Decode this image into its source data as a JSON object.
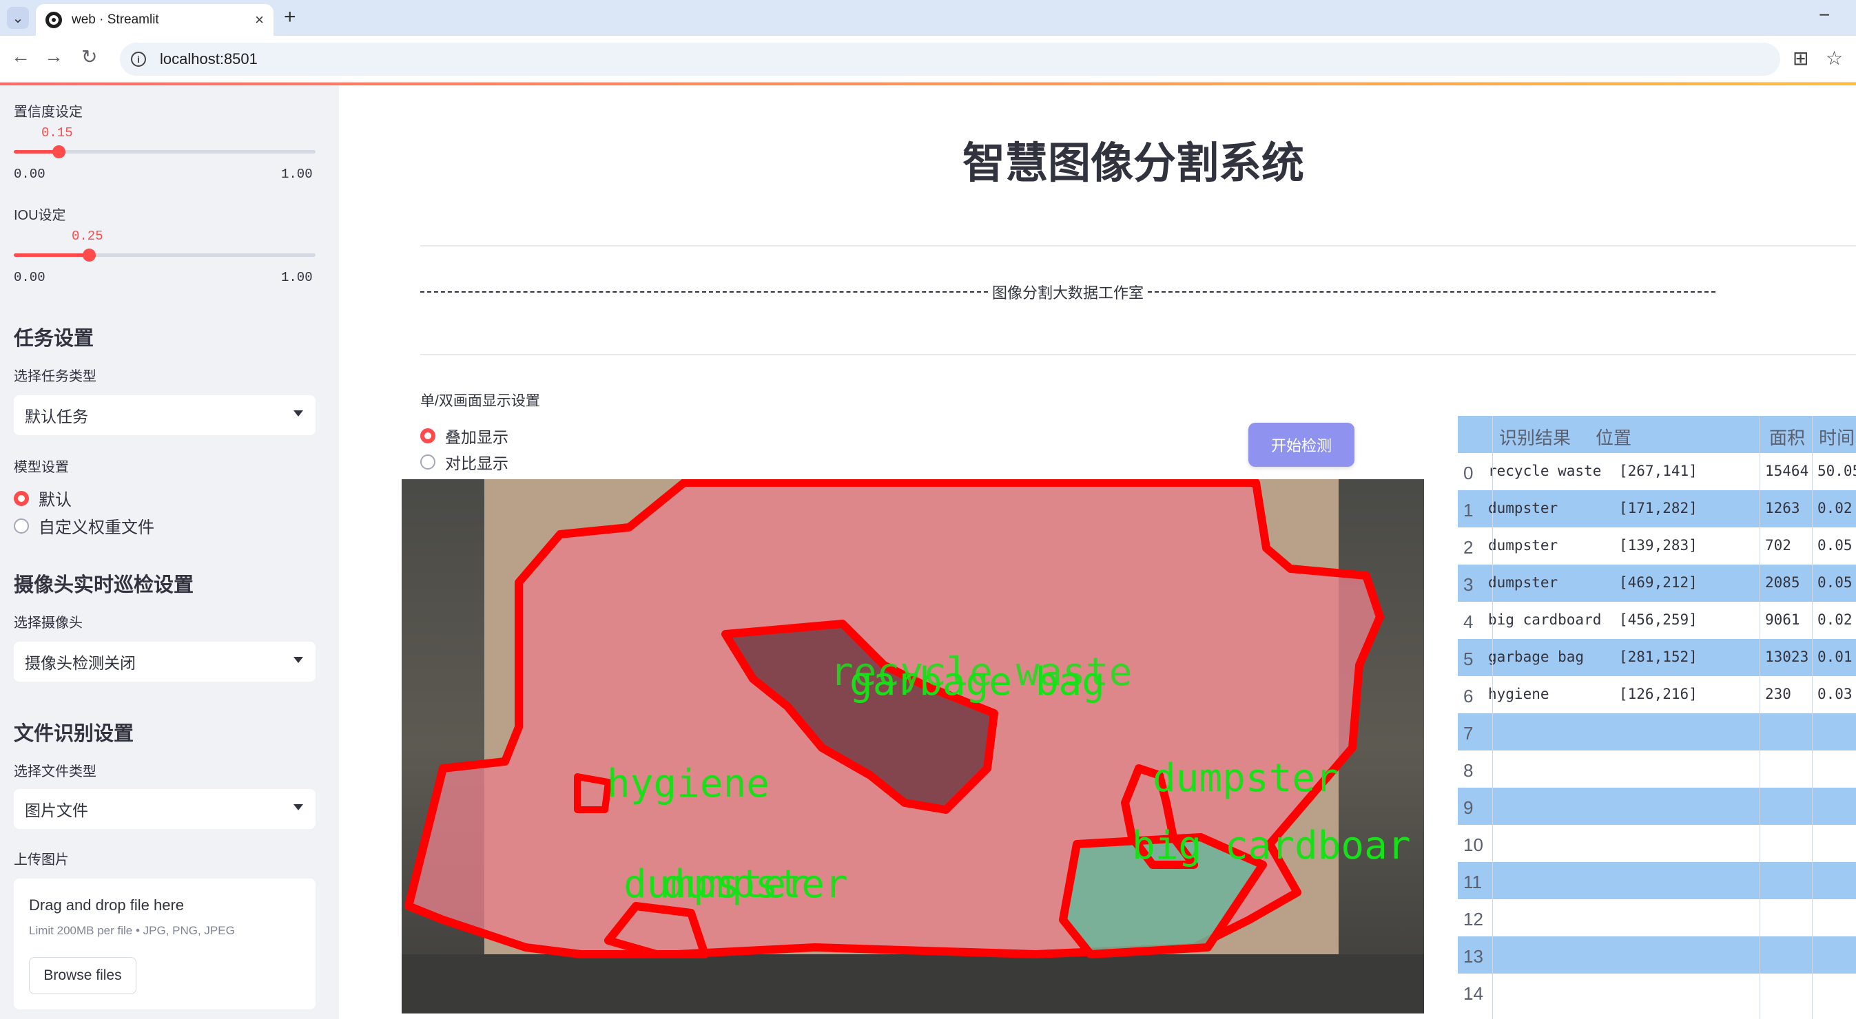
{
  "browser": {
    "tab_title": "web · Streamlit",
    "url": "localhost:8501",
    "new_tab": "+",
    "close": "×",
    "minimize": "−"
  },
  "sidebar": {
    "confidence": {
      "label": "置信度设定",
      "value": "0.15",
      "min": "0.00",
      "max": "1.00",
      "fraction": 0.15
    },
    "iou": {
      "label": "IOU设定",
      "value": "0.25",
      "min": "0.00",
      "max": "1.00",
      "fraction": 0.25
    },
    "task_header": "任务设置",
    "task_type_label": "选择任务类型",
    "task_type_value": "默认任务",
    "model_label": "模型设置",
    "model_options": [
      "默认",
      "自定义权重文件"
    ],
    "camera_header": "摄像头实时巡检设置",
    "camera_label": "选择摄像头",
    "camera_value": "摄像头检测关闭",
    "file_header": "文件识别设置",
    "file_type_label": "选择文件类型",
    "file_type_value": "图片文件",
    "upload_label": "上传图片",
    "upload_drag": "Drag and drop file here",
    "upload_limit": "Limit 200MB per file • JPG, PNG, JPEG",
    "upload_button": "Browse files"
  },
  "main": {
    "title": "智慧图像分割系统",
    "studio": "图像分割大数据工作室",
    "display_label": "单/双画面显示设置",
    "display_options": [
      "叠加显示",
      "对比显示"
    ],
    "start_button": "开始检测",
    "overlay_labels": [
      "recycle waste",
      "garbage bag",
      "hygiene",
      "dumpster",
      "big cardboar",
      "dumpster",
      "dumpster"
    ]
  },
  "table": {
    "headers": [
      "识别结果",
      "位置",
      "面积",
      "时间"
    ],
    "rows": [
      {
        "i": "0",
        "name": "recycle waste",
        "pos": "[267,141]",
        "area": "15464",
        "time": "50.05"
      },
      {
        "i": "1",
        "name": "dumpster",
        "pos": "[171,282]",
        "area": "1263",
        "time": "0.02"
      },
      {
        "i": "2",
        "name": "dumpster",
        "pos": "[139,283]",
        "area": "702",
        "time": "0.05"
      },
      {
        "i": "3",
        "name": "dumpster",
        "pos": "[469,212]",
        "area": "2085",
        "time": "0.05"
      },
      {
        "i": "4",
        "name": "big cardboard",
        "pos": "[456,259]",
        "area": "9061",
        "time": "0.02"
      },
      {
        "i": "5",
        "name": "garbage bag",
        "pos": "[281,152]",
        "area": "13023",
        "time": "0.01"
      },
      {
        "i": "6",
        "name": "hygiene",
        "pos": "[126,216]",
        "area": "230",
        "time": "0.03"
      },
      {
        "i": "7",
        "name": "",
        "pos": "",
        "area": "",
        "time": ""
      },
      {
        "i": "8",
        "name": "",
        "pos": "",
        "area": "",
        "time": ""
      },
      {
        "i": "9",
        "name": "",
        "pos": "",
        "area": "",
        "time": ""
      },
      {
        "i": "10",
        "name": "",
        "pos": "",
        "area": "",
        "time": ""
      },
      {
        "i": "11",
        "name": "",
        "pos": "",
        "area": "",
        "time": ""
      },
      {
        "i": "12",
        "name": "",
        "pos": "",
        "area": "",
        "time": ""
      },
      {
        "i": "13",
        "name": "",
        "pos": "",
        "area": "",
        "time": ""
      },
      {
        "i": "14",
        "name": "",
        "pos": "",
        "area": "",
        "time": ""
      }
    ]
  },
  "colors": {
    "accent": "#ff4b4b",
    "button": "#8f93ef",
    "table_stripe": "#9ec9f3",
    "overlay_text": "#18e018",
    "mask_outline": "#ff0000"
  }
}
